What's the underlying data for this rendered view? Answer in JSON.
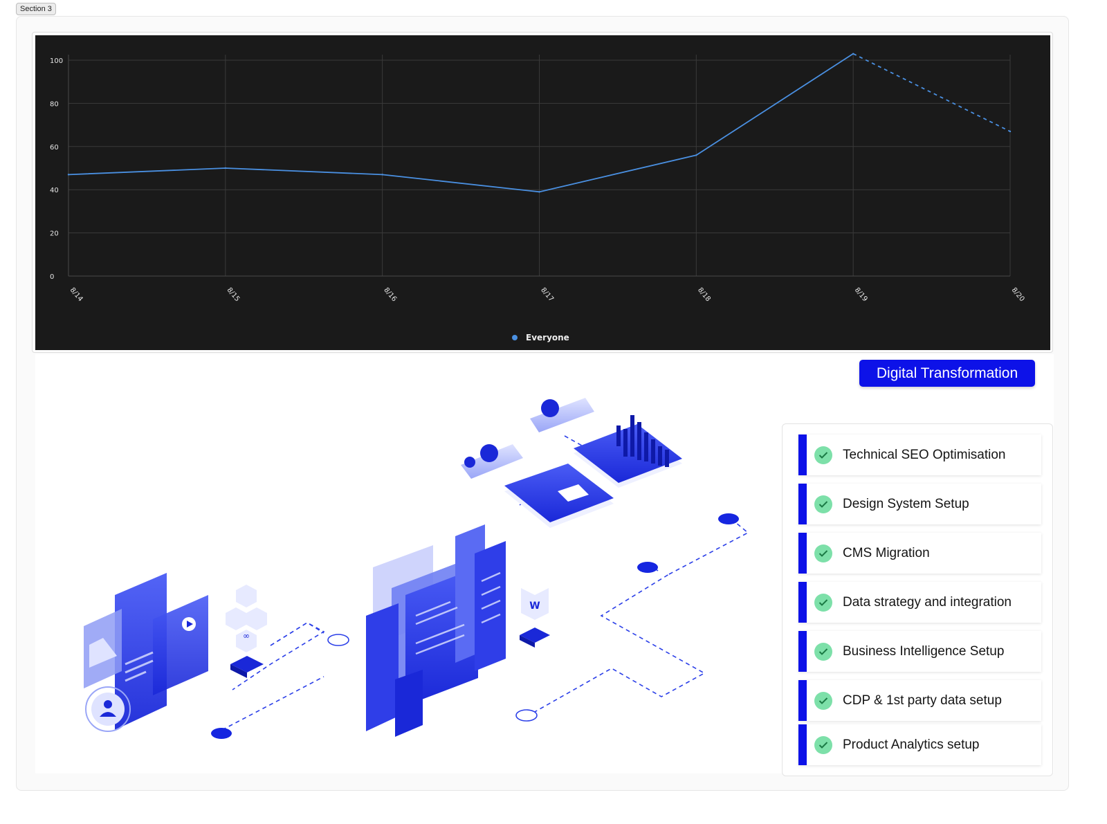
{
  "section_tag": "Section 3",
  "chart_data": {
    "type": "line",
    "categories": [
      "8/14",
      "8/15",
      "8/16",
      "8/17",
      "8/18",
      "8/19",
      "8/20"
    ],
    "series": [
      {
        "name": "Everyone",
        "values": [
          47,
          50,
          47,
          39,
          56,
          103,
          67
        ],
        "dashed_last_segment": true
      }
    ],
    "ylim": [
      0,
      100
    ],
    "yticks": [
      0,
      20,
      40,
      60,
      80,
      100
    ],
    "grid": true,
    "legend_position": "bottom-center",
    "background": "#1a1a1a",
    "line_color": "#4a90e2"
  },
  "badge": {
    "title": "Digital Transformation",
    "color": "#0d12e8"
  },
  "services": [
    {
      "label": "Technical SEO Optimisation"
    },
    {
      "label": "Design System Setup"
    },
    {
      "label": "CMS Migration"
    },
    {
      "label": "Data strategy and integration"
    },
    {
      "label": "Business Intelligence Setup"
    },
    {
      "label": "CDP & 1st party data setup"
    },
    {
      "label": "Product Analytics setup"
    }
  ],
  "check_color": "#7de0a9",
  "illustration": {
    "icons": [
      "image-icon",
      "play-icon",
      "user-icon",
      "meta-icon",
      "webflow-icon",
      "bar-chart-icon",
      "mail-icon"
    ]
  }
}
